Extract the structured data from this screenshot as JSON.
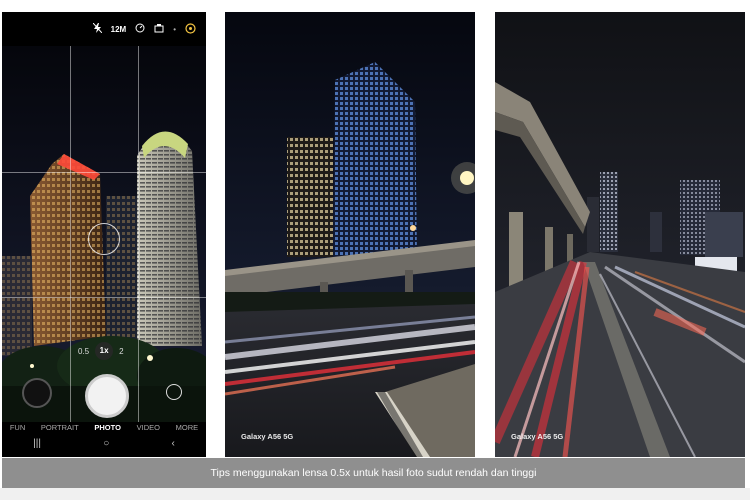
{
  "camera": {
    "top_bar": {
      "flash_icon": "flash-off-icon",
      "resolution": "12M",
      "timer_icon": "timer-icon",
      "ratio_icon": "ratio-icon",
      "dot": "•",
      "settings_icon": "settings-icon"
    },
    "zoom_levels": [
      "0.5",
      "1x",
      "2"
    ],
    "modes": [
      "FUN",
      "PORTRAIT",
      "PHOTO",
      "VIDEO",
      "MORE"
    ],
    "active_mode": "PHOTO",
    "nav": [
      "|||",
      "○",
      "‹"
    ]
  },
  "photos": [
    {
      "watermark": "Galaxy A56 5G"
    },
    {
      "watermark": "Galaxy A56 5G"
    }
  ],
  "caption": "Tips menggunakan lensa 0.5x untuk hasil foto sudut rendah dan tinggi",
  "colors": {
    "caption_bg": "#8f8f8f",
    "night_sky": "#0b0d16",
    "tail_lights": "#e8303a",
    "headlights": "#f4f4ff"
  }
}
